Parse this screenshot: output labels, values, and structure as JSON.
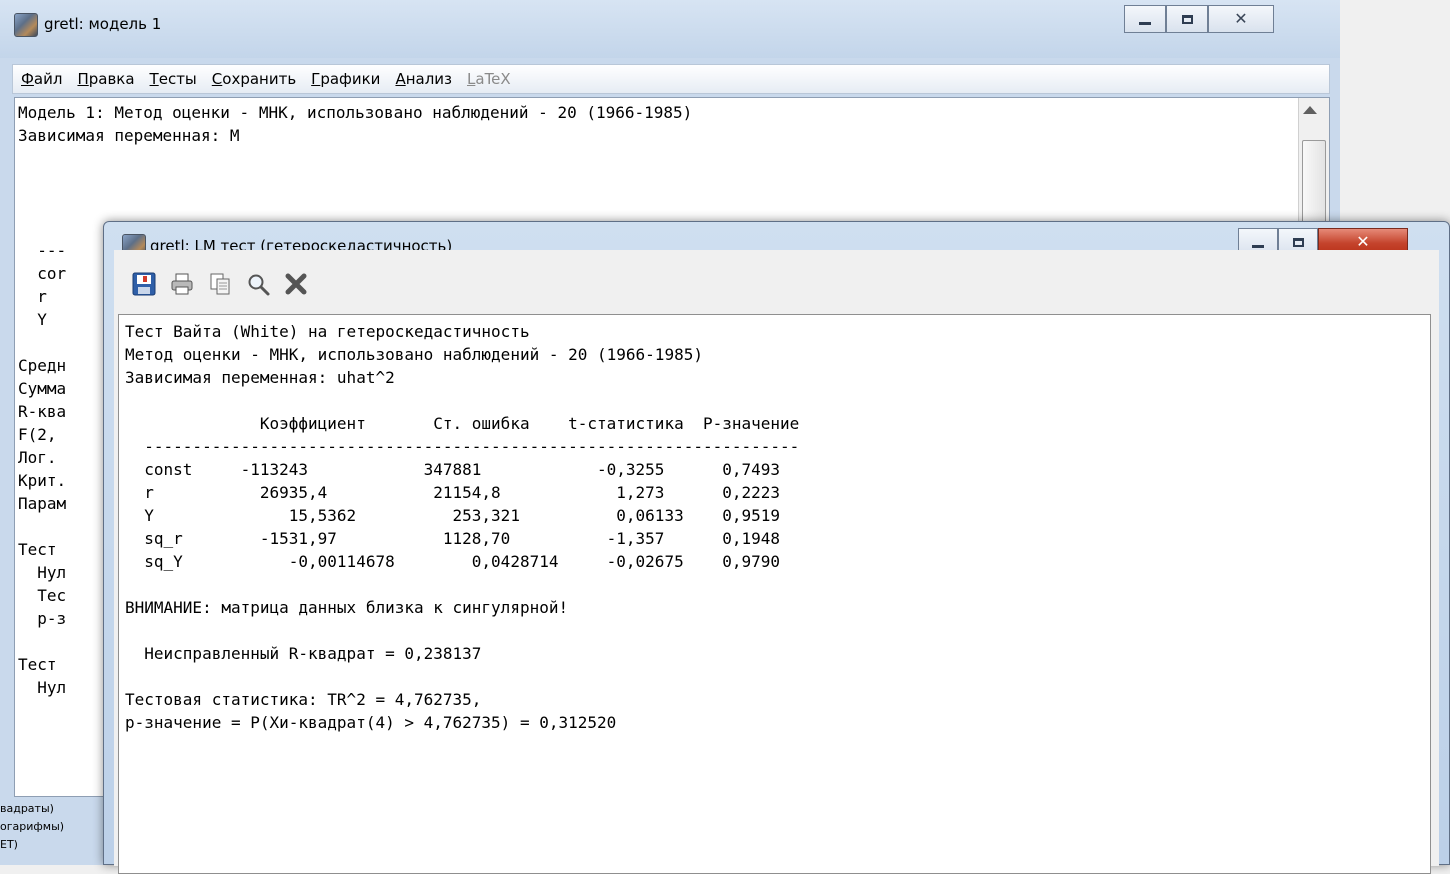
{
  "back_window": {
    "title": "gretl: модель 1",
    "menu": [
      {
        "label": "Файл",
        "ul": "Ф",
        "rest": "айл",
        "disabled": false
      },
      {
        "label": "Правка",
        "ul": "П",
        "rest": "равка",
        "disabled": false
      },
      {
        "label": "Тесты",
        "ul": "Т",
        "rest": "есты",
        "disabled": false
      },
      {
        "label": "Сохранить",
        "ul": "С",
        "rest": "охранить",
        "disabled": false
      },
      {
        "label": "Графики",
        "ul": "Г",
        "rest": "рафики",
        "disabled": false
      },
      {
        "label": "Анализ",
        "ul": "А",
        "rest": "нализ",
        "disabled": false
      },
      {
        "label": "LaTeX",
        "ul": "L",
        "rest": "aTeX",
        "disabled": true
      }
    ],
    "text_lines": [
      "Модель 1: Метод оценки - МНК, использовано наблюдений - 20 (1966-1985)",
      "Зависимая переменная: M"
    ],
    "fragments": [
      "  ---",
      "  cor",
      "  r",
      "  Y",
      "",
      "Средн",
      "Сумма",
      "R-ква",
      "F(2,",
      "Лог.",
      "Крит.",
      "Парам",
      "",
      "Тест",
      "  Нул",
      "  Тес",
      "  p-з",
      "",
      "Тест",
      "  Нул"
    ],
    "status_lines": [
      "вадраты)",
      "огарифмы)",
      "ET)"
    ]
  },
  "front_window": {
    "title": "gretl: LM тест (гетероскедастичность)",
    "toolbar": [
      {
        "name": "save-icon"
      },
      {
        "name": "print-icon"
      },
      {
        "name": "copy-icon"
      },
      {
        "name": "find-icon"
      },
      {
        "name": "close-icon"
      }
    ],
    "text_lines": [
      "Тест Вайта (White) на гетероскедастичность",
      "Метод оценки - МНК, использовано наблюдений - 20 (1966-1985)",
      "Зависимая переменная: uhat^2",
      "",
      "              Коэффициент       Ст. ошибка    t-статистика  P-значение",
      "  --------------------------------------------------------------------",
      "  const     -113243            347881            -0,3255      0,7493",
      "  r           26935,4           21154,8            1,273      0,2223",
      "  Y              15,5362          253,321          0,06133    0,9519",
      "  sq_r        -1531,97           1128,70          -1,357      0,1948",
      "  sq_Y           -0,00114678        0,0428714     -0,02675    0,9790",
      "",
      "ВНИМАНИЕ: матрица данных близка к сингулярной!",
      "",
      "  Неисправленный R-квадрат = 0,238137",
      "",
      "Тестовая статистика: TR^2 = 4,762735,",
      "p-значение = P(Хи-квадрат(4) > 4,762735) = 0,312520"
    ]
  }
}
